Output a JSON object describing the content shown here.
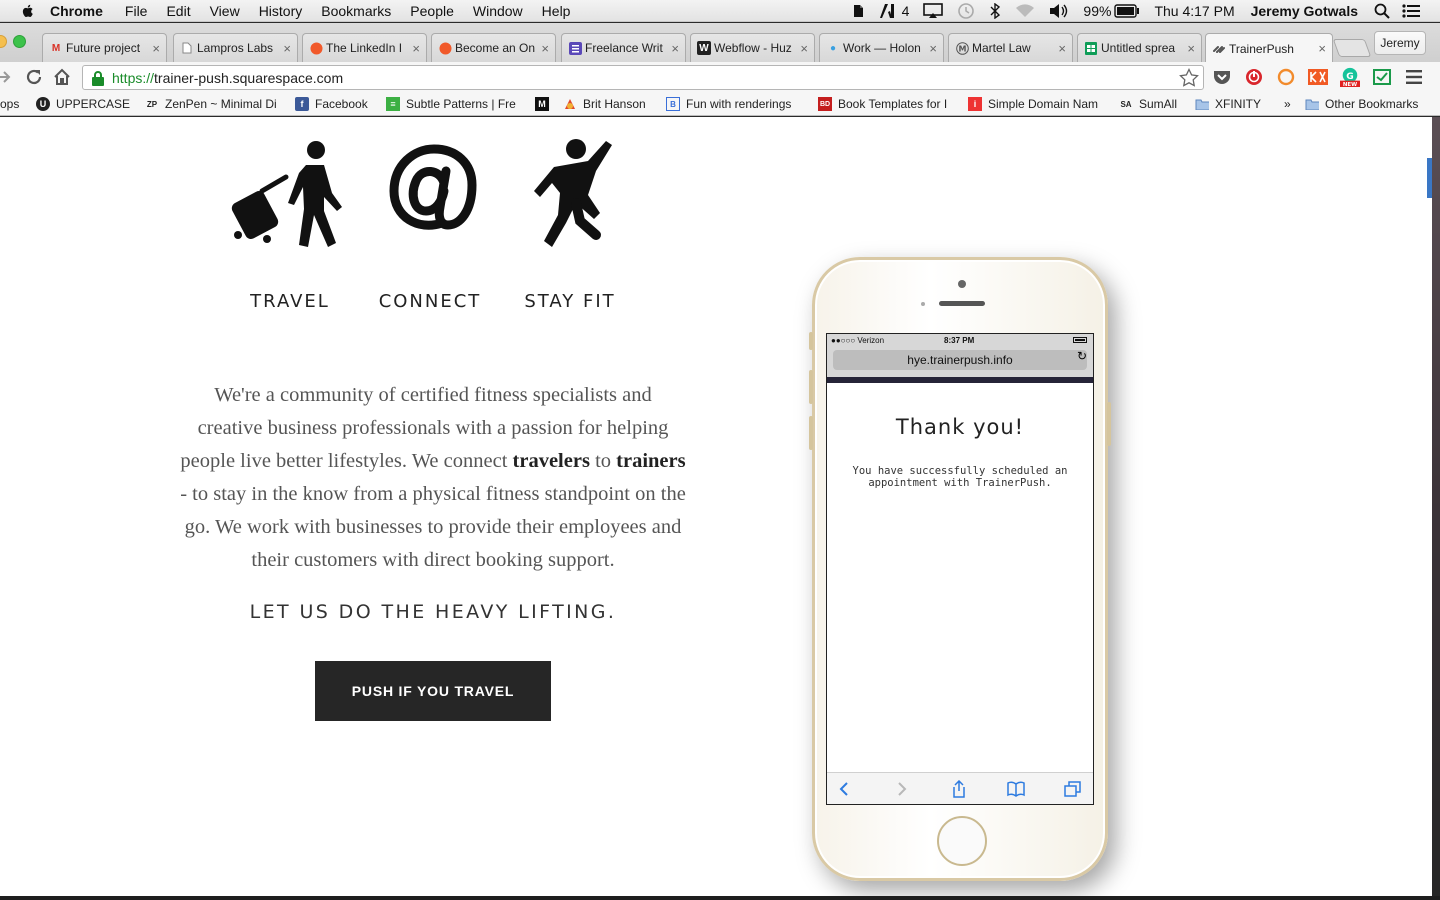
{
  "menubar": {
    "app": "Chrome",
    "items": [
      "File",
      "Edit",
      "View",
      "History",
      "Bookmarks",
      "People",
      "Window",
      "Help"
    ],
    "notification_count": "4",
    "battery": "99%",
    "clock": "Thu 4:17 PM",
    "user": "Jeremy Gotwals"
  },
  "tabs": [
    {
      "label": "Future project",
      "icon": "gmail-icon",
      "color": "#d93025"
    },
    {
      "label": "Lampros Labs",
      "icon": "page-icon",
      "color": "#888888"
    },
    {
      "label": "The LinkedIn I",
      "icon": "orange-circle-icon",
      "color": "#f1592a"
    },
    {
      "label": "Become an On",
      "icon": "orange-circle-icon",
      "color": "#f1592a"
    },
    {
      "label": "Freelance Writ",
      "icon": "list-icon",
      "color": "#5a48b8"
    },
    {
      "label": "Webflow - Huz",
      "icon": "webflow-icon",
      "color": "#222222"
    },
    {
      "label": "Work — Holon",
      "icon": "drop-icon",
      "color": "#3aa0e0"
    },
    {
      "label": "Martel Law",
      "icon": "m-icon",
      "color": "#555555"
    },
    {
      "label": "Untitled sprea",
      "icon": "sheets-icon",
      "color": "#0f9d58"
    },
    {
      "label": "TrainerPush",
      "icon": "squarespace-icon",
      "color": "#555555",
      "active": true
    }
  ],
  "profile": "Jeremy",
  "address": {
    "scheme": "https://",
    "host": "trainer-push.squarespace.com"
  },
  "bookmarks": [
    {
      "label": "ops",
      "icon": ""
    },
    {
      "label": "UPPERCASE",
      "icon": "u-icon"
    },
    {
      "label": "ZenPen ~ Minimal Di",
      "icon": "zp-icon"
    },
    {
      "label": "Facebook",
      "icon": "facebook-icon"
    },
    {
      "label": "Subtle Patterns | Fre",
      "icon": "subtle-patterns-icon"
    },
    {
      "label": "",
      "icon": "medium-icon"
    },
    {
      "label": "Brit Hanson",
      "icon": "brit-icon"
    },
    {
      "label": "Fun with renderings",
      "icon": "bracket-icon"
    },
    {
      "label": "Book Templates for I",
      "icon": "book-icon"
    },
    {
      "label": "Simple Domain Nam",
      "icon": "info-icon"
    },
    {
      "label": "SumAll",
      "icon": "sa-icon"
    },
    {
      "label": "XFINITY",
      "icon": "folder-icon"
    },
    {
      "label": "»",
      "icon": ""
    },
    {
      "label": "Other Bookmarks",
      "icon": "folder-icon"
    }
  ],
  "page": {
    "icons": [
      {
        "label": "TRAVEL",
        "icon": "traveler-icon"
      },
      {
        "label": "CONNECT",
        "icon": "connect-at-icon"
      },
      {
        "label": "STAY FIT",
        "icon": "runner-icon"
      }
    ],
    "intro": {
      "part1": "We're a community of certified fitness specialists and creative business professionals with a passion for helping people live better lifestyles. We connect ",
      "bold1": "travelers",
      "part2": " to ",
      "bold2": "trainers",
      "part3": " - to stay in the know from a physical fitness standpoint on the go. We work with businesses to provide their employees and their customers with direct booking support."
    },
    "tagline": "LET US DO THE HEAVY LIFTING.",
    "cta": "PUSH IF YOU TRAVEL"
  },
  "phone": {
    "carrier": "●●○○○ Verizon",
    "time": "8:37 PM",
    "url": "hye.trainerpush.info",
    "title": "Thank you!",
    "message": "You have successfully scheduled an appointment with TrainerPush."
  },
  "colors": {
    "cta_bg": "#262626",
    "secure_green": "#1a8c2a",
    "phone_gold": "#d9c9a5"
  }
}
